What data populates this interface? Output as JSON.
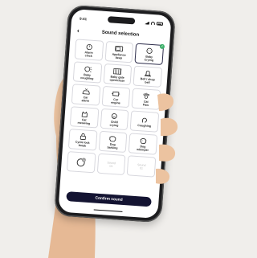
{
  "status": {
    "time": "9:41"
  },
  "header": {
    "title": "Sound selection",
    "back_icon": "chevron-left-icon"
  },
  "tiles": [
    {
      "label": "Alarm\nclock",
      "icon": "alarm-clock-icon"
    },
    {
      "label": "Appliance\nbeep",
      "icon": "microwave-icon"
    },
    {
      "label": "Baby\nCrying",
      "icon": "baby-icon",
      "selected": true
    },
    {
      "label": "Baby\ncoughing",
      "icon": "baby-cough-icon"
    },
    {
      "label": "Baby gate\nopen/close",
      "icon": "gate-icon"
    },
    {
      "label": "Bell / shop\nbell",
      "icon": "bell-icon"
    },
    {
      "label": "Car\nalarm",
      "icon": "car-alarm-icon"
    },
    {
      "label": "Car\nengine",
      "icon": "engine-icon"
    },
    {
      "label": "Cat\nPaw",
      "icon": "paw-icon"
    },
    {
      "label": "Cat\nmeowing",
      "icon": "cat-icon"
    },
    {
      "label": "Child\ncrying",
      "icon": "child-icon"
    },
    {
      "label": "Coughing",
      "icon": "cough-icon"
    },
    {
      "label": "Cycle lock\nbreak",
      "icon": "lock-icon"
    },
    {
      "label": "Dog\nbarking",
      "icon": "dog-icon"
    },
    {
      "label": "Dog\nwhimper",
      "icon": "dog-whimper-icon"
    }
  ],
  "record_slots": [
    {
      "label": "",
      "icon": "record-icon"
    },
    {
      "label": "Sound\n01"
    },
    {
      "label": "Sound\n01"
    }
  ],
  "confirm_label": "Confirm sound",
  "colors": {
    "accent": "#141432",
    "selected_check": "#3db06a"
  }
}
